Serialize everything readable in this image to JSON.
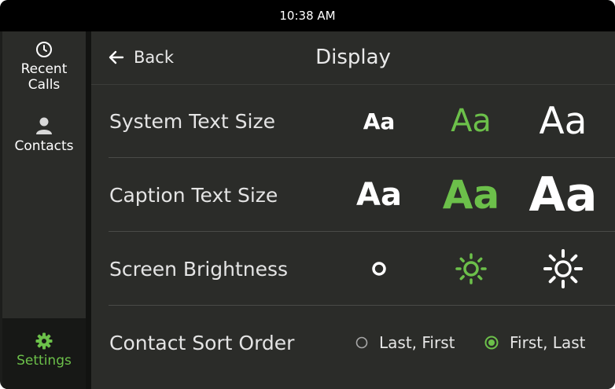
{
  "status_bar": {
    "time": "10:38 AM"
  },
  "sidebar": {
    "items": [
      {
        "label": "Recent Calls",
        "icon": "clock-icon"
      },
      {
        "label": "Contacts",
        "icon": "person-icon"
      },
      {
        "label": "Settings",
        "icon": "gear-icon",
        "selected": true
      }
    ]
  },
  "header": {
    "back_label": "Back",
    "title": "Display"
  },
  "settings": {
    "system_text_size": {
      "label": "System Text Size",
      "options": [
        "Aa",
        "Aa",
        "Aa"
      ],
      "selected_index": 1
    },
    "caption_text_size": {
      "label": "Caption Text Size",
      "options": [
        "Aa",
        "Aa",
        "Aa"
      ],
      "selected_index": 1
    },
    "screen_brightness": {
      "label": "Screen Brightness",
      "options": [
        "brightness-low-icon",
        "brightness-medium-icon",
        "brightness-high-icon"
      ],
      "selected_index": 1
    },
    "contact_sort_order": {
      "label": "Contact Sort Order",
      "options": [
        "Last, First",
        "First, Last"
      ],
      "selected_index": 1
    }
  },
  "colors": {
    "accent": "#6cc04a",
    "background": "#2b2c29",
    "status_bar": "#000000",
    "text": "#e4e4e4"
  }
}
